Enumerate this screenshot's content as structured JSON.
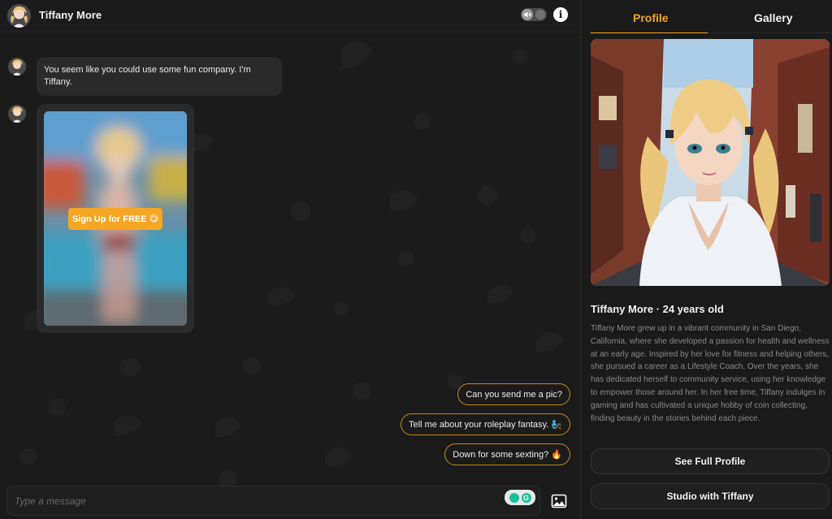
{
  "header": {
    "name": "Tiffany More",
    "avatar_icon": "avatar-icon",
    "mute_icon": "speaker-muted-icon",
    "info_label": "i"
  },
  "messages": [
    {
      "type": "text",
      "text": "You seem like you could use some fun company. I'm Tiffany."
    },
    {
      "type": "locked-image",
      "button_label": "Sign Up for FREE 😋"
    }
  ],
  "suggestions": [
    "Can you send me a pic?",
    "Tell me about your roleplay fantasy. 🧞",
    "Down for some sexting? 🔥"
  ],
  "composer": {
    "placeholder": "Type a message",
    "upload_icon": "image-upload-icon"
  },
  "sidebar": {
    "tabs": [
      {
        "label": "Profile",
        "active": true
      },
      {
        "label": "Gallery",
        "active": false
      }
    ],
    "title": "Tiffany More · 24 years old",
    "bio": "Tiffany More grew up in a vibrant community in San Diego, California, where she developed a passion for health and wellness at an early age. Inspired by her love for fitness and helping others, she pursued a career as a Lifestyle Coach. Over the years, she has dedicated herself to community service, using her knowledge to empower those around her. In her free time, Tiffany indulges in gaming and has cultivated a unique hobby of coin collecting, finding beauty in the stories behind each piece.",
    "buttons": {
      "full_profile": "See Full Profile",
      "studio": "Studio with Tiffany"
    }
  },
  "colors": {
    "accent": "#f5a623",
    "background": "#1b1b1b",
    "bubble": "#2a2a2a",
    "chip_border": "#c88a20"
  }
}
